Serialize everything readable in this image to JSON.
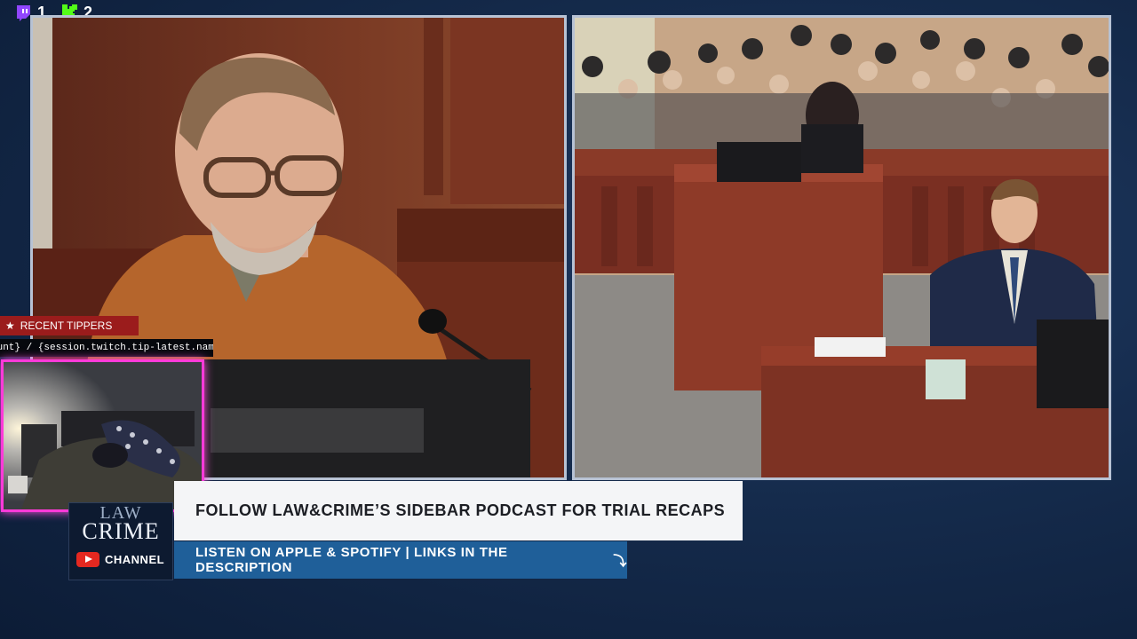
{
  "top_bar": {
    "twitch_count": "1",
    "kick_count": "2",
    "colors": {
      "twitch": "#9146ff",
      "kick": "#53fc18"
    }
  },
  "videos": {
    "left_feed_icon": "courtroom-witness-video",
    "right_feed_icon": "courtroom-gallery-video"
  },
  "overlay": {
    "recent_tippers_label": "RECENT TIPPERS",
    "ticker_text": "ount} / {session.twitch.tip-latest.name} ${session"
  },
  "brand": {
    "logo_line1": "LAW",
    "logo_line2": "CRIME",
    "channel_label": "CHANNEL",
    "accent": "#1f5f99"
  },
  "banner": {
    "headline": "FOLLOW LAW&CRIME’S SIDEBAR PODCAST FOR TRIAL RECAPS",
    "subline": "LISTEN ON APPLE & SPOTIFY | LINKS IN THE DESCRIPTION",
    "arrow_icon": "arrow-down-turn-icon"
  }
}
